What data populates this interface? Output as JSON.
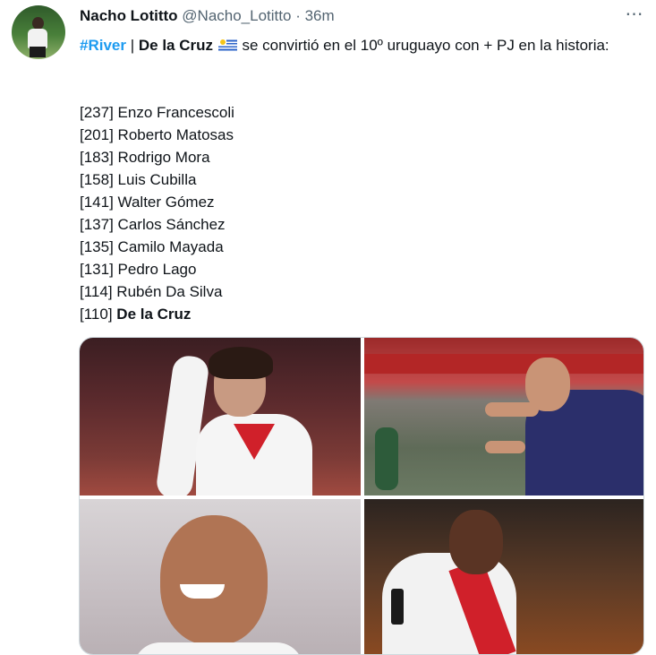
{
  "tweet": {
    "display_name": "Nacho Lotitto",
    "handle": "@Nacho_Lotitto",
    "separator": "·",
    "time": "36m",
    "more_icon": "⋯",
    "text": {
      "hashtag": "#River",
      "divider": " | ",
      "bold_name": "De la Cruz",
      "flag_icon": "uruguay-flag-icon",
      "rest_line": " se convirtió en el 10º uruguayo con + PJ en la historia:"
    },
    "list": [
      {
        "count": "[237]",
        "name": "Enzo Francescoli"
      },
      {
        "count": "[201]",
        "name": "Roberto Matosas"
      },
      {
        "count": "[183]",
        "name": "Rodrigo Mora"
      },
      {
        "count": "[158]",
        "name": "Luis Cubilla"
      },
      {
        "count": "[141]",
        "name": "Walter Gómez"
      },
      {
        "count": "[137]",
        "name": "Carlos Sánchez"
      },
      {
        "count": "[135]",
        "name": "Camilo Mayada"
      },
      {
        "count": "[131]",
        "name": "Pedro Lago"
      },
      {
        "count": "[114]",
        "name": "Rubén Da Silva"
      },
      {
        "count": "[110]",
        "name": "De la Cruz",
        "bold": true
      }
    ],
    "media": {
      "photos": [
        "player-photo-1",
        "player-photo-2",
        "player-photo-3",
        "player-photo-4"
      ]
    }
  }
}
